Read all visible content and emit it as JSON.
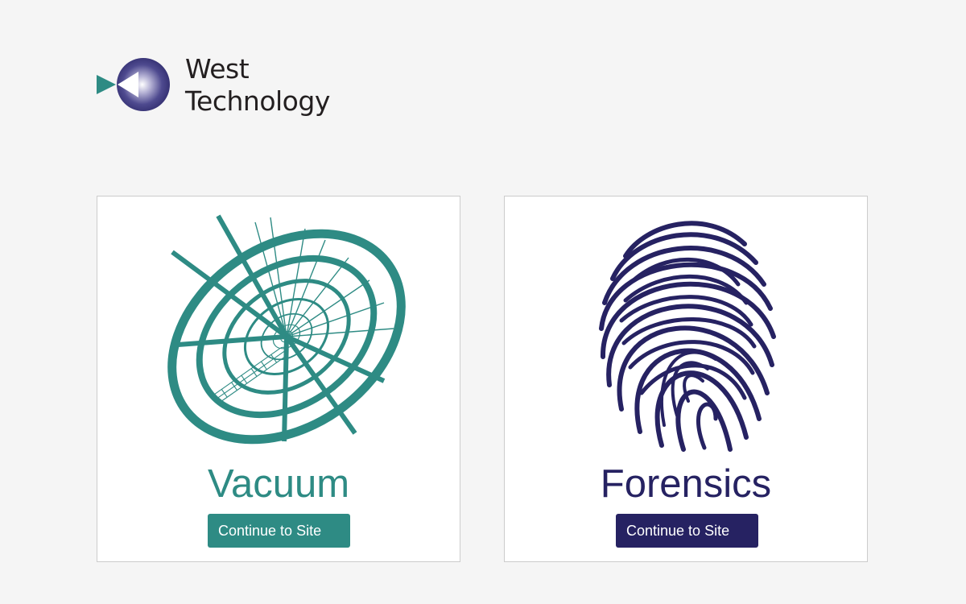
{
  "brand": {
    "name_line1": "West",
    "name_line2": "Technology",
    "colors": {
      "teal": "#2e8b84",
      "navy": "#262262"
    }
  },
  "cards": [
    {
      "id": "vacuum",
      "title": "Vacuum",
      "button_label": "Continue to Site",
      "icon": "vacuum-vortex-icon",
      "accent": "#2e8b84"
    },
    {
      "id": "forensics",
      "title": "Forensics",
      "button_label": "Continue to Site",
      "icon": "fingerprint-icon",
      "accent": "#262262"
    }
  ]
}
